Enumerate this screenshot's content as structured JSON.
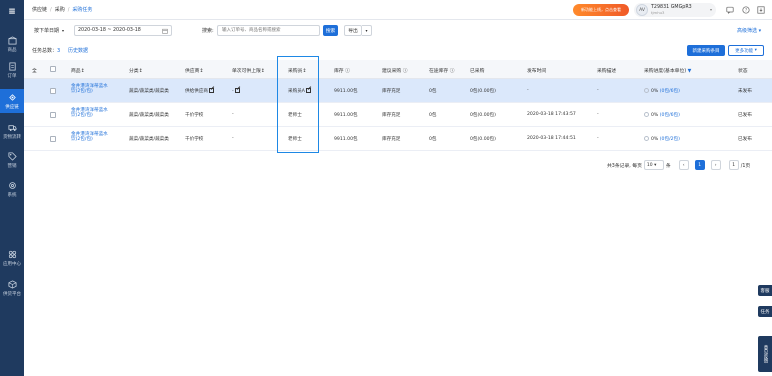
{
  "breadcrumb": [
    "供应链",
    "采购",
    "采购任务"
  ],
  "promo_text": "新功能上线，点击查看",
  "user": {
    "initials": "AV",
    "id": "T29831 GMGpR3",
    "sub": "tjmhu3"
  },
  "sidebar": [
    {
      "label": "商品",
      "icon": "box-icon"
    },
    {
      "label": "订单",
      "icon": "document-icon"
    },
    {
      "label": "供应链",
      "icon": "chain-icon"
    },
    {
      "label": "货物流转",
      "icon": "truck-icon"
    },
    {
      "label": "营销",
      "icon": "tag-icon"
    },
    {
      "label": "系统",
      "icon": "gear-icon"
    },
    {
      "label": "应用中心",
      "icon": "apps-icon"
    },
    {
      "label": "供货平台",
      "icon": "cube-icon"
    }
  ],
  "filters": {
    "date_type": "按下单日期",
    "date_range": "2020-03-18 ~ 2020-03-18",
    "search_label": "搜索:",
    "search_placeholder": "输入订单号、商品名称或搜索",
    "search_button": "搜索",
    "export_button": "导出",
    "advanced_filter": "高级筛选"
  },
  "summary": {
    "count_label": "任务总数：",
    "count_value": "3",
    "history_link": "历史数据",
    "new_button": "新建采购条目",
    "more_button": "更多功能"
  },
  "columns": [
    "全",
    "商品",
    "分类",
    "供应商",
    "单次可供上限",
    "采购员",
    "库存",
    "建议采购",
    "在途库存",
    "已采购",
    "发布时间",
    "采购描述",
    "采购进度(基本单位)",
    "状态"
  ],
  "rows": [
    {
      "product": "金井港湾洋蒂蓝水饮(2包/包)",
      "category": "蔬菜/蔬菜类/蔬菜类",
      "supplier": "供给供应商",
      "limit": "-",
      "buyer": "采购员A",
      "stock": "9911.00包",
      "suggest": "库存充足",
      "in_transit": "0包",
      "purchased": "0包(0.00包)",
      "publish_time": "-",
      "desc": "-",
      "progress_pct": "0%",
      "progress_text": "(0包/6包)",
      "status": "未发布"
    },
    {
      "product": "金井港湾洋蒂蓝水饮(2包/包)",
      "category": "蔬菜/蔬菜类/蔬菜类",
      "supplier": "千价学校",
      "limit": "-",
      "buyer": "老师士",
      "stock": "9911.00包",
      "suggest": "库存充足",
      "in_transit": "0包",
      "purchased": "0包(0.00包)",
      "publish_time": "2020-03-18 17:43:57",
      "desc": "-",
      "progress_pct": "0%",
      "progress_text": "(0包/6包)",
      "status": "已发布"
    },
    {
      "product": "金井港湾洋蒂蓝水饮(2包/包)",
      "category": "蔬菜/蔬菜类/蔬菜类",
      "supplier": "千价学校",
      "limit": "-",
      "buyer": "老师士",
      "stock": "9911.00包",
      "suggest": "库存充足",
      "in_transit": "0包",
      "purchased": "0包(0.00包)",
      "publish_time": "2020-03-18 17:44:51",
      "desc": "-",
      "progress_pct": "0%",
      "progress_text": "(0包/2包)",
      "status": "已发布"
    }
  ],
  "pagination": {
    "total_label": "共3条记录, 每页",
    "page_size": "10",
    "unit": "条",
    "prev": "‹",
    "current": "1",
    "next": "›",
    "jump_value": "1",
    "jump_label": "/1页"
  },
  "float_tabs": [
    "客服",
    "任务",
    "意见反馈"
  ],
  "colors": {
    "sidebar": "#1f3a5f",
    "accent": "#1e6fd9",
    "selected_row": "#dbe8fb",
    "promo": "#f05a28"
  }
}
